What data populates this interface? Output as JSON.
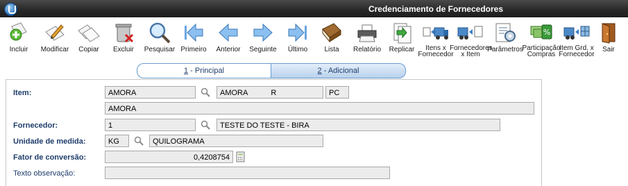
{
  "window": {
    "title": "Credenciamento de Fornecedores"
  },
  "toolbar": {
    "items": [
      {
        "label": "Incluir",
        "icon": "add-document-icon"
      },
      {
        "label": "Modificar",
        "icon": "edit-document-icon"
      },
      {
        "label": "Copiar",
        "icon": "copy-document-icon"
      },
      {
        "label": "Excluir",
        "icon": "trash-icon"
      },
      {
        "label": "Pesquisar",
        "icon": "magnifier-icon"
      },
      {
        "label": "Primeiro",
        "icon": "first-arrow-icon"
      },
      {
        "label": "Anterior",
        "icon": "previous-arrow-icon"
      },
      {
        "label": "Seguinte",
        "icon": "next-arrow-icon"
      },
      {
        "label": "Último",
        "icon": "last-arrow-icon"
      },
      {
        "label": "Lista",
        "icon": "book-icon"
      },
      {
        "label": "Relatório",
        "icon": "printer-icon"
      },
      {
        "label": "Replicar",
        "icon": "replicate-icon"
      },
      {
        "label": "Itens x Fornecedor",
        "icon": "truck-items-icon"
      },
      {
        "label": "Fornecedores x Item",
        "icon": "truck-suppliers-icon"
      },
      {
        "label": "Parâmetros",
        "icon": "settings-document-icon"
      },
      {
        "label": "Participação Compras",
        "icon": "money-percent-icon"
      },
      {
        "label": "Item Grd. x Fornecedor",
        "icon": "truck-grid-icon"
      },
      {
        "label": "Sair",
        "icon": "exit-door-icon"
      }
    ]
  },
  "tabs": [
    {
      "key": "1",
      "label": " - Principal"
    },
    {
      "key": "2",
      "label": " - Adicional"
    }
  ],
  "form": {
    "item": {
      "label": "Item:",
      "code": "AMORA",
      "short": "AMORA           R",
      "unit": "PC",
      "description": "AMORA"
    },
    "fornecedor": {
      "label": "Fornecedor:",
      "code": "1",
      "name": "TESTE DO TESTE - BIRA"
    },
    "unidade": {
      "label": "Unidade de medida:",
      "code": "KG",
      "name": "QUILOGRAMA"
    },
    "fator": {
      "label": "Fator de conversão:",
      "value": "0,4208754"
    },
    "observacao": {
      "label": "Texto observação:",
      "value": ""
    }
  },
  "colors": {
    "label": "#1f3d6b",
    "titlebar": "#2a2a2a",
    "tab_border": "#6a9ccf"
  }
}
